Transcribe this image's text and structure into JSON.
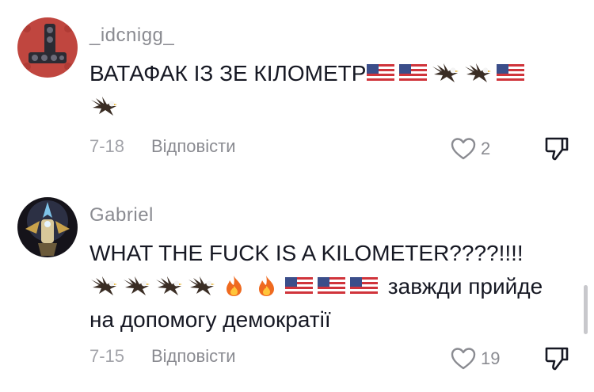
{
  "comments": [
    {
      "username": "_idcnigg_",
      "text_parts": [
        "ВАТАФАК ІЗ ЗЕ КІЛОМЕТР",
        ""
      ],
      "emoji_sequence": [
        "us-flag-icon",
        "us-flag-icon",
        "eagle-icon",
        "eagle-icon",
        "us-flag-icon",
        "eagle-icon"
      ],
      "date": "7-18",
      "reply_label": "Відповісти",
      "like_count": "2"
    },
    {
      "username": "Gabriel",
      "text_parts": [
        "WHAT THE FUCK IS A KILOMETER????!!!!",
        "завжди прийде на допомогу демократії"
      ],
      "emoji_sequence": [
        "eagle-icon",
        "eagle-icon",
        "eagle-icon",
        "eagle-icon",
        "fire-icon",
        "fire-icon",
        "us-flag-icon",
        "us-flag-icon",
        "us-flag-icon"
      ],
      "date": "7-15",
      "reply_label": "Відповісти",
      "like_count": "19"
    }
  ],
  "colors": {
    "username": "#8a8b91",
    "text": "#161823",
    "meta": "#a3a4aa",
    "avatar1_bg": "#c0463f"
  }
}
